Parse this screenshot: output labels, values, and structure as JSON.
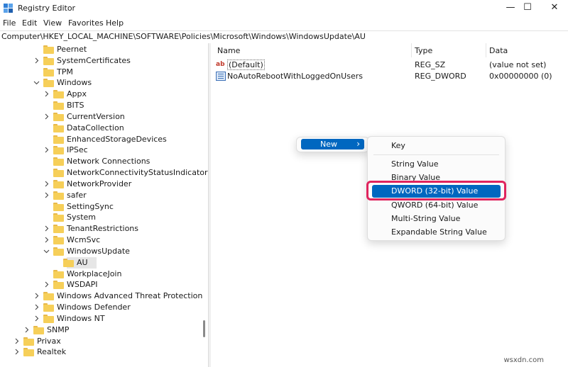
{
  "window": {
    "title": "Registry Editor",
    "controls": {
      "minimize": "—",
      "maximize": "☐",
      "close": "✕"
    }
  },
  "menu": [
    "File",
    "Edit",
    "View",
    "Favorites",
    "Help"
  ],
  "address": "Computer\\HKEY_LOCAL_MACHINE\\SOFTWARE\\Policies\\Microsoft\\Windows\\WindowsUpdate\\AU",
  "tree": [
    {
      "label": "Peernet",
      "depth": 3,
      "chevron": "none",
      "selected": false
    },
    {
      "label": "SystemCertificates",
      "depth": 3,
      "chevron": "right",
      "selected": false
    },
    {
      "label": "TPM",
      "depth": 3,
      "chevron": "none",
      "selected": false
    },
    {
      "label": "Windows",
      "depth": 3,
      "chevron": "down",
      "selected": false
    },
    {
      "label": "Appx",
      "depth": 4,
      "chevron": "right",
      "selected": false
    },
    {
      "label": "BITS",
      "depth": 4,
      "chevron": "none",
      "selected": false
    },
    {
      "label": "CurrentVersion",
      "depth": 4,
      "chevron": "right",
      "selected": false
    },
    {
      "label": "DataCollection",
      "depth": 4,
      "chevron": "none",
      "selected": false
    },
    {
      "label": "EnhancedStorageDevices",
      "depth": 4,
      "chevron": "none",
      "selected": false
    },
    {
      "label": "IPSec",
      "depth": 4,
      "chevron": "right",
      "selected": false
    },
    {
      "label": "Network Connections",
      "depth": 4,
      "chevron": "none",
      "selected": false
    },
    {
      "label": "NetworkConnectivityStatusIndicator",
      "depth": 4,
      "chevron": "none",
      "selected": false
    },
    {
      "label": "NetworkProvider",
      "depth": 4,
      "chevron": "right",
      "selected": false
    },
    {
      "label": "safer",
      "depth": 4,
      "chevron": "right",
      "selected": false
    },
    {
      "label": "SettingSync",
      "depth": 4,
      "chevron": "none",
      "selected": false
    },
    {
      "label": "System",
      "depth": 4,
      "chevron": "none",
      "selected": false
    },
    {
      "label": "TenantRestrictions",
      "depth": 4,
      "chevron": "right",
      "selected": false
    },
    {
      "label": "WcmSvc",
      "depth": 4,
      "chevron": "right",
      "selected": false
    },
    {
      "label": "WindowsUpdate",
      "depth": 4,
      "chevron": "down",
      "selected": false
    },
    {
      "label": "AU",
      "depth": 5,
      "chevron": "none",
      "selected": true
    },
    {
      "label": "WorkplaceJoin",
      "depth": 4,
      "chevron": "none",
      "selected": false
    },
    {
      "label": "WSDAPI",
      "depth": 4,
      "chevron": "right",
      "selected": false
    },
    {
      "label": "Windows Advanced Threat Protection",
      "depth": 3,
      "chevron": "right",
      "selected": false
    },
    {
      "label": "Windows Defender",
      "depth": 3,
      "chevron": "right",
      "selected": false
    },
    {
      "label": "Windows NT",
      "depth": 3,
      "chevron": "right",
      "selected": false
    },
    {
      "label": "SNMP",
      "depth": 2,
      "chevron": "right",
      "selected": false
    },
    {
      "label": "Privax",
      "depth": 1,
      "chevron": "right",
      "selected": false
    },
    {
      "label": "Realtek",
      "depth": 1,
      "chevron": "right",
      "selected": false
    }
  ],
  "list": {
    "headers": {
      "name": "Name",
      "type": "Type",
      "data": "Data"
    },
    "rows": [
      {
        "icon": "string-value-icon",
        "name": "(Default)",
        "type": "REG_SZ",
        "data": "(value not set)"
      },
      {
        "icon": "binary-value-icon",
        "name": "NoAutoRebootWithLoggedOnUsers",
        "type": "REG_DWORD",
        "data": "0x00000000 (0)"
      }
    ]
  },
  "context_menu": {
    "new_label": "New",
    "arrow": "›"
  },
  "submenu": [
    {
      "label": "Key",
      "highlighted": false
    },
    {
      "label": "String Value",
      "highlighted": false
    },
    {
      "label": "Binary Value",
      "highlighted": false
    },
    {
      "label": "DWORD (32-bit) Value",
      "highlighted": true
    },
    {
      "label": "QWORD (64-bit) Value",
      "highlighted": false
    },
    {
      "label": "Multi-String Value",
      "highlighted": false
    },
    {
      "label": "Expandable String Value",
      "highlighted": false
    }
  ],
  "colors": {
    "accent": "#0067c0",
    "highlight_border": "#e0245e",
    "folder": "#f6cf59"
  },
  "watermark": "wsxdn.com"
}
